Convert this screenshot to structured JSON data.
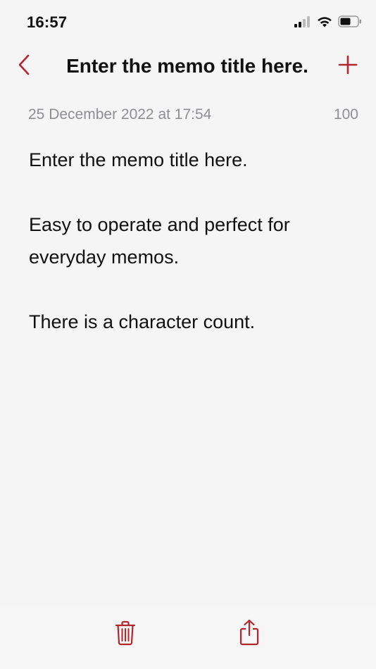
{
  "status_bar": {
    "time": "16:57",
    "icons": [
      "cellular-signal-icon",
      "wifi-icon",
      "battery-icon"
    ]
  },
  "nav": {
    "title": "Enter the memo title here.",
    "back_icon": "chevron-left-icon",
    "add_icon": "plus-icon"
  },
  "memo": {
    "date": "25 December 2022 at 17:54",
    "char_count": "100",
    "lines": [
      "Enter the memo title here.",
      "",
      "Easy to operate and perfect for",
      "everyday memos.",
      "",
      "There is a character count."
    ]
  },
  "toolbar": {
    "icons": [
      "trash-icon",
      "share-icon"
    ]
  },
  "colors": {
    "accent": "#b3262e",
    "background": "#f5f5f5",
    "secondary_text": "#8e8e93"
  }
}
